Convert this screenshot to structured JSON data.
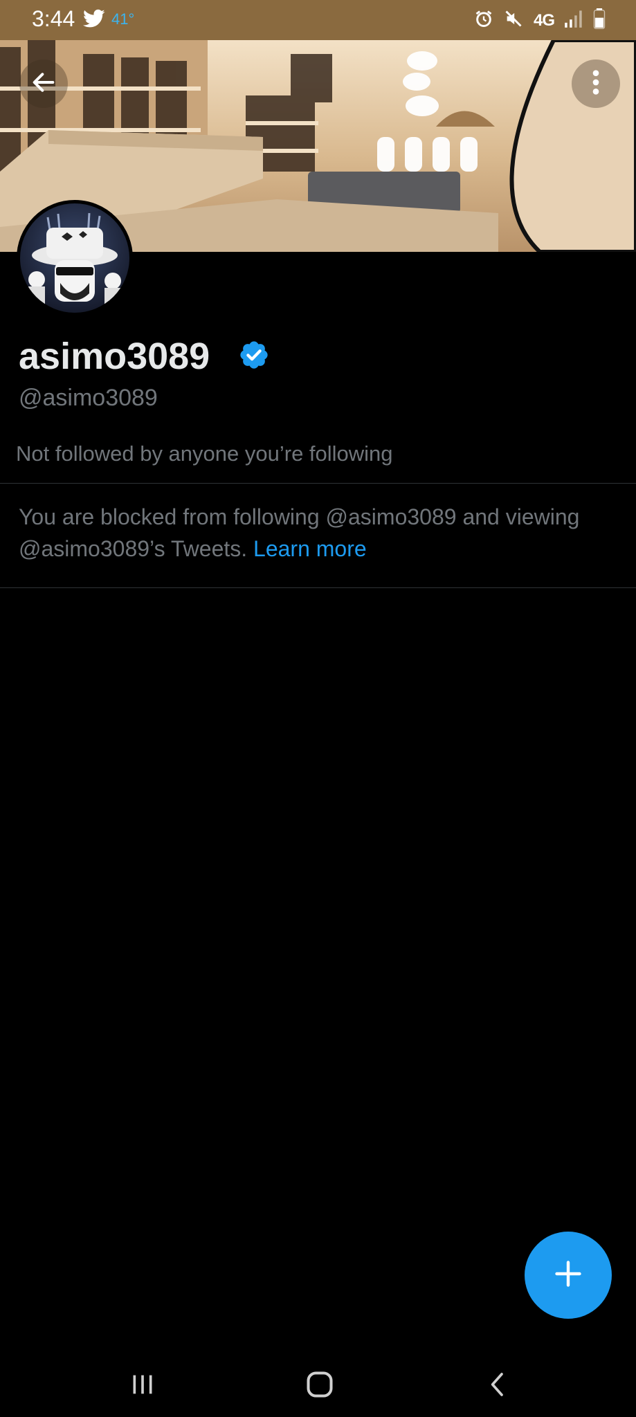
{
  "status_bar": {
    "time": "3:44",
    "temperature": "41°",
    "network": "4G",
    "icons": [
      "twitter-icon",
      "alarm-icon",
      "mute-icon",
      "signal-icon",
      "battery-icon"
    ]
  },
  "header": {
    "back_icon": "arrow-left-icon",
    "more_icon": "more-vertical-icon"
  },
  "profile": {
    "display_name": "asimo3089",
    "handle": "@asimo3089",
    "verified": true,
    "followers_note": "Not followed by anyone you’re following"
  },
  "blocked": {
    "message": "You are blocked from following @asimo3089 and viewing @asimo3089’s Tweets.",
    "link_label": "Learn more"
  },
  "fab": {
    "icon": "plus-icon"
  },
  "nav_bar": {
    "icons": [
      "recent-apps-icon",
      "home-icon",
      "back-icon"
    ]
  },
  "colors": {
    "accent": "#1d9bf0",
    "background": "#000000",
    "status_bar": "#8a6a3f"
  }
}
